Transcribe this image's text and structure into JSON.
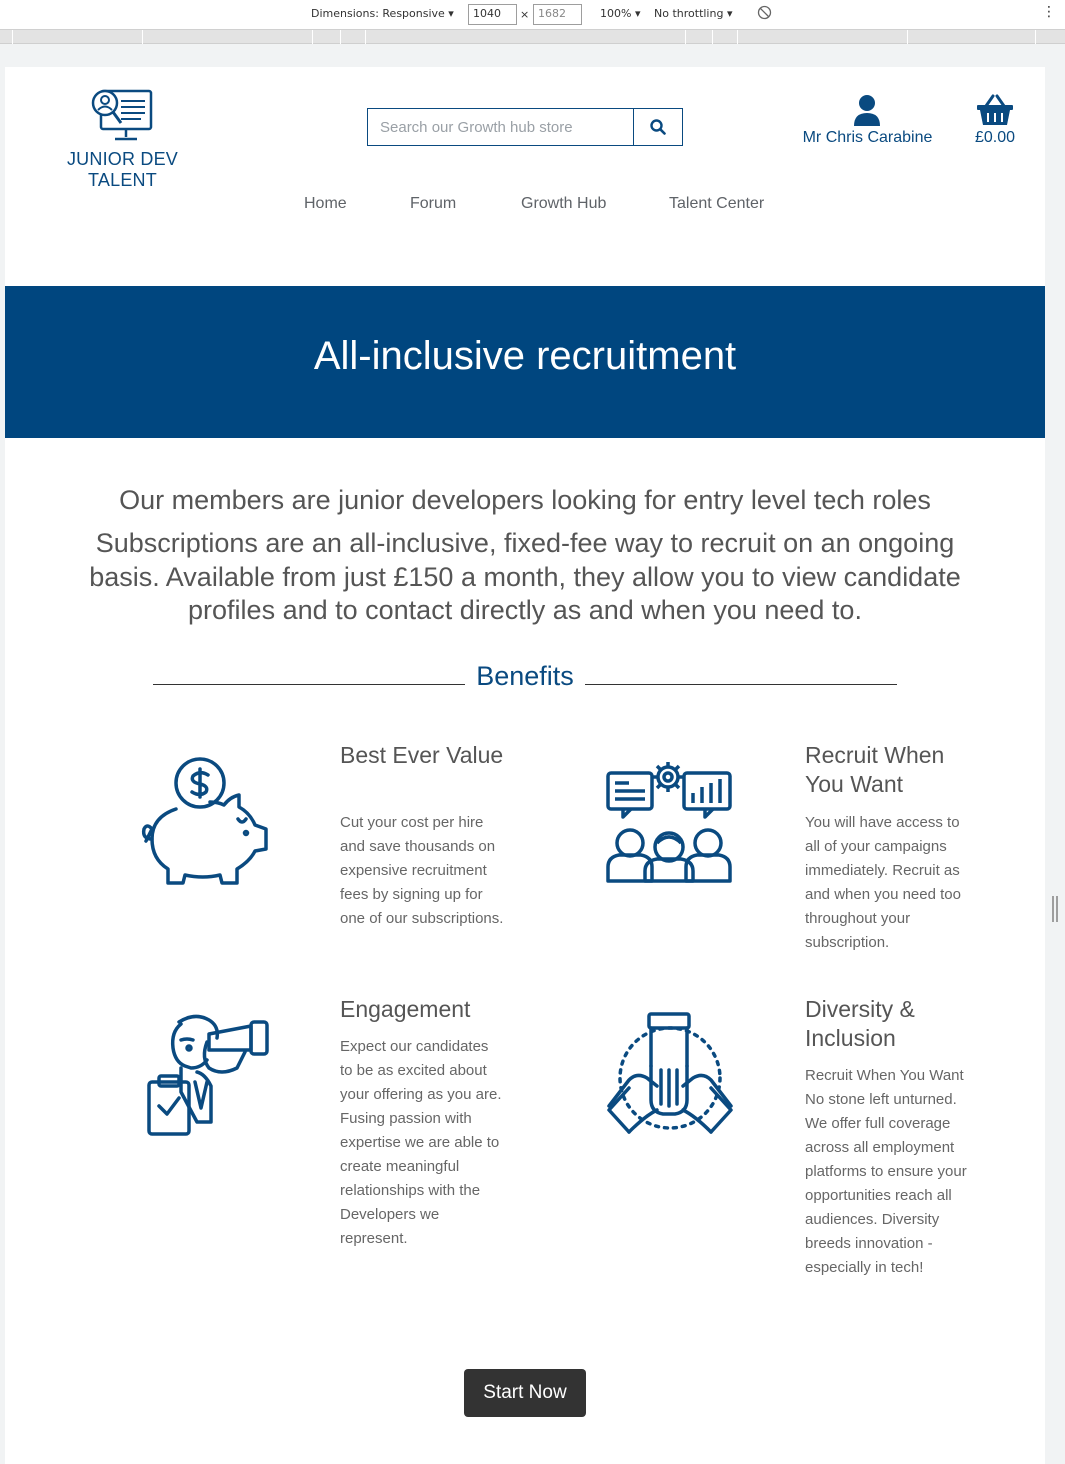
{
  "devtools": {
    "dimensions_label": "Dimensions: Responsive",
    "width_value": "1040",
    "times": "×",
    "height_value": "1682",
    "zoom": "100%",
    "throttling": "No throttling"
  },
  "header": {
    "logo_text": "JUNIOR DEV TALENT",
    "search_placeholder": "Search our Growth hub store",
    "account_name": "Mr Chris Carabine",
    "cart_total": "£0.00"
  },
  "nav": {
    "items": [
      "Home",
      "Forum",
      "Growth Hub",
      "Talent Center"
    ]
  },
  "hero": {
    "title": "All-inclusive recruitment"
  },
  "intro": {
    "line1": "Our members are junior developers looking for entry level tech roles",
    "line2": "Subscriptions are an all-inclusive, fixed-fee way to recruit on an ongoing basis. Available from just £150 a month, they allow you to view candidate profiles and to contact directly as and when you need to."
  },
  "benefits": {
    "heading": "Benefits",
    "items": [
      {
        "title": "Best Ever Value",
        "text": "Cut your cost per hire and save thousands on expensive recruitment fees by signing up for one of our subscriptions.",
        "icon": "piggy-bank-icon"
      },
      {
        "title": "Recruit When You Want",
        "text": "You will have access to all of your campaigns immediately. Recruit as and when you need too throughout your subscription.",
        "icon": "team-analytics-icon"
      },
      {
        "title": "Engagement",
        "text": "Expect our candidates to be as excited about your offering as you are. Fusing passion with expertise we are able to create meaningful relationships with the Developers we represent.",
        "icon": "telescope-person-icon"
      },
      {
        "title": "Diversity & Inclusion",
        "text": "Recruit When You Want No stone left unturned. We offer full coverage across all employment platforms to ensure your opportunities reach all audiences. Diversity breeds innovation - especially in tech!",
        "icon": "hands-together-icon"
      }
    ]
  },
  "cta": {
    "label": "Start Now"
  },
  "colors": {
    "brand": "#00467f",
    "dark_button": "#333333"
  }
}
